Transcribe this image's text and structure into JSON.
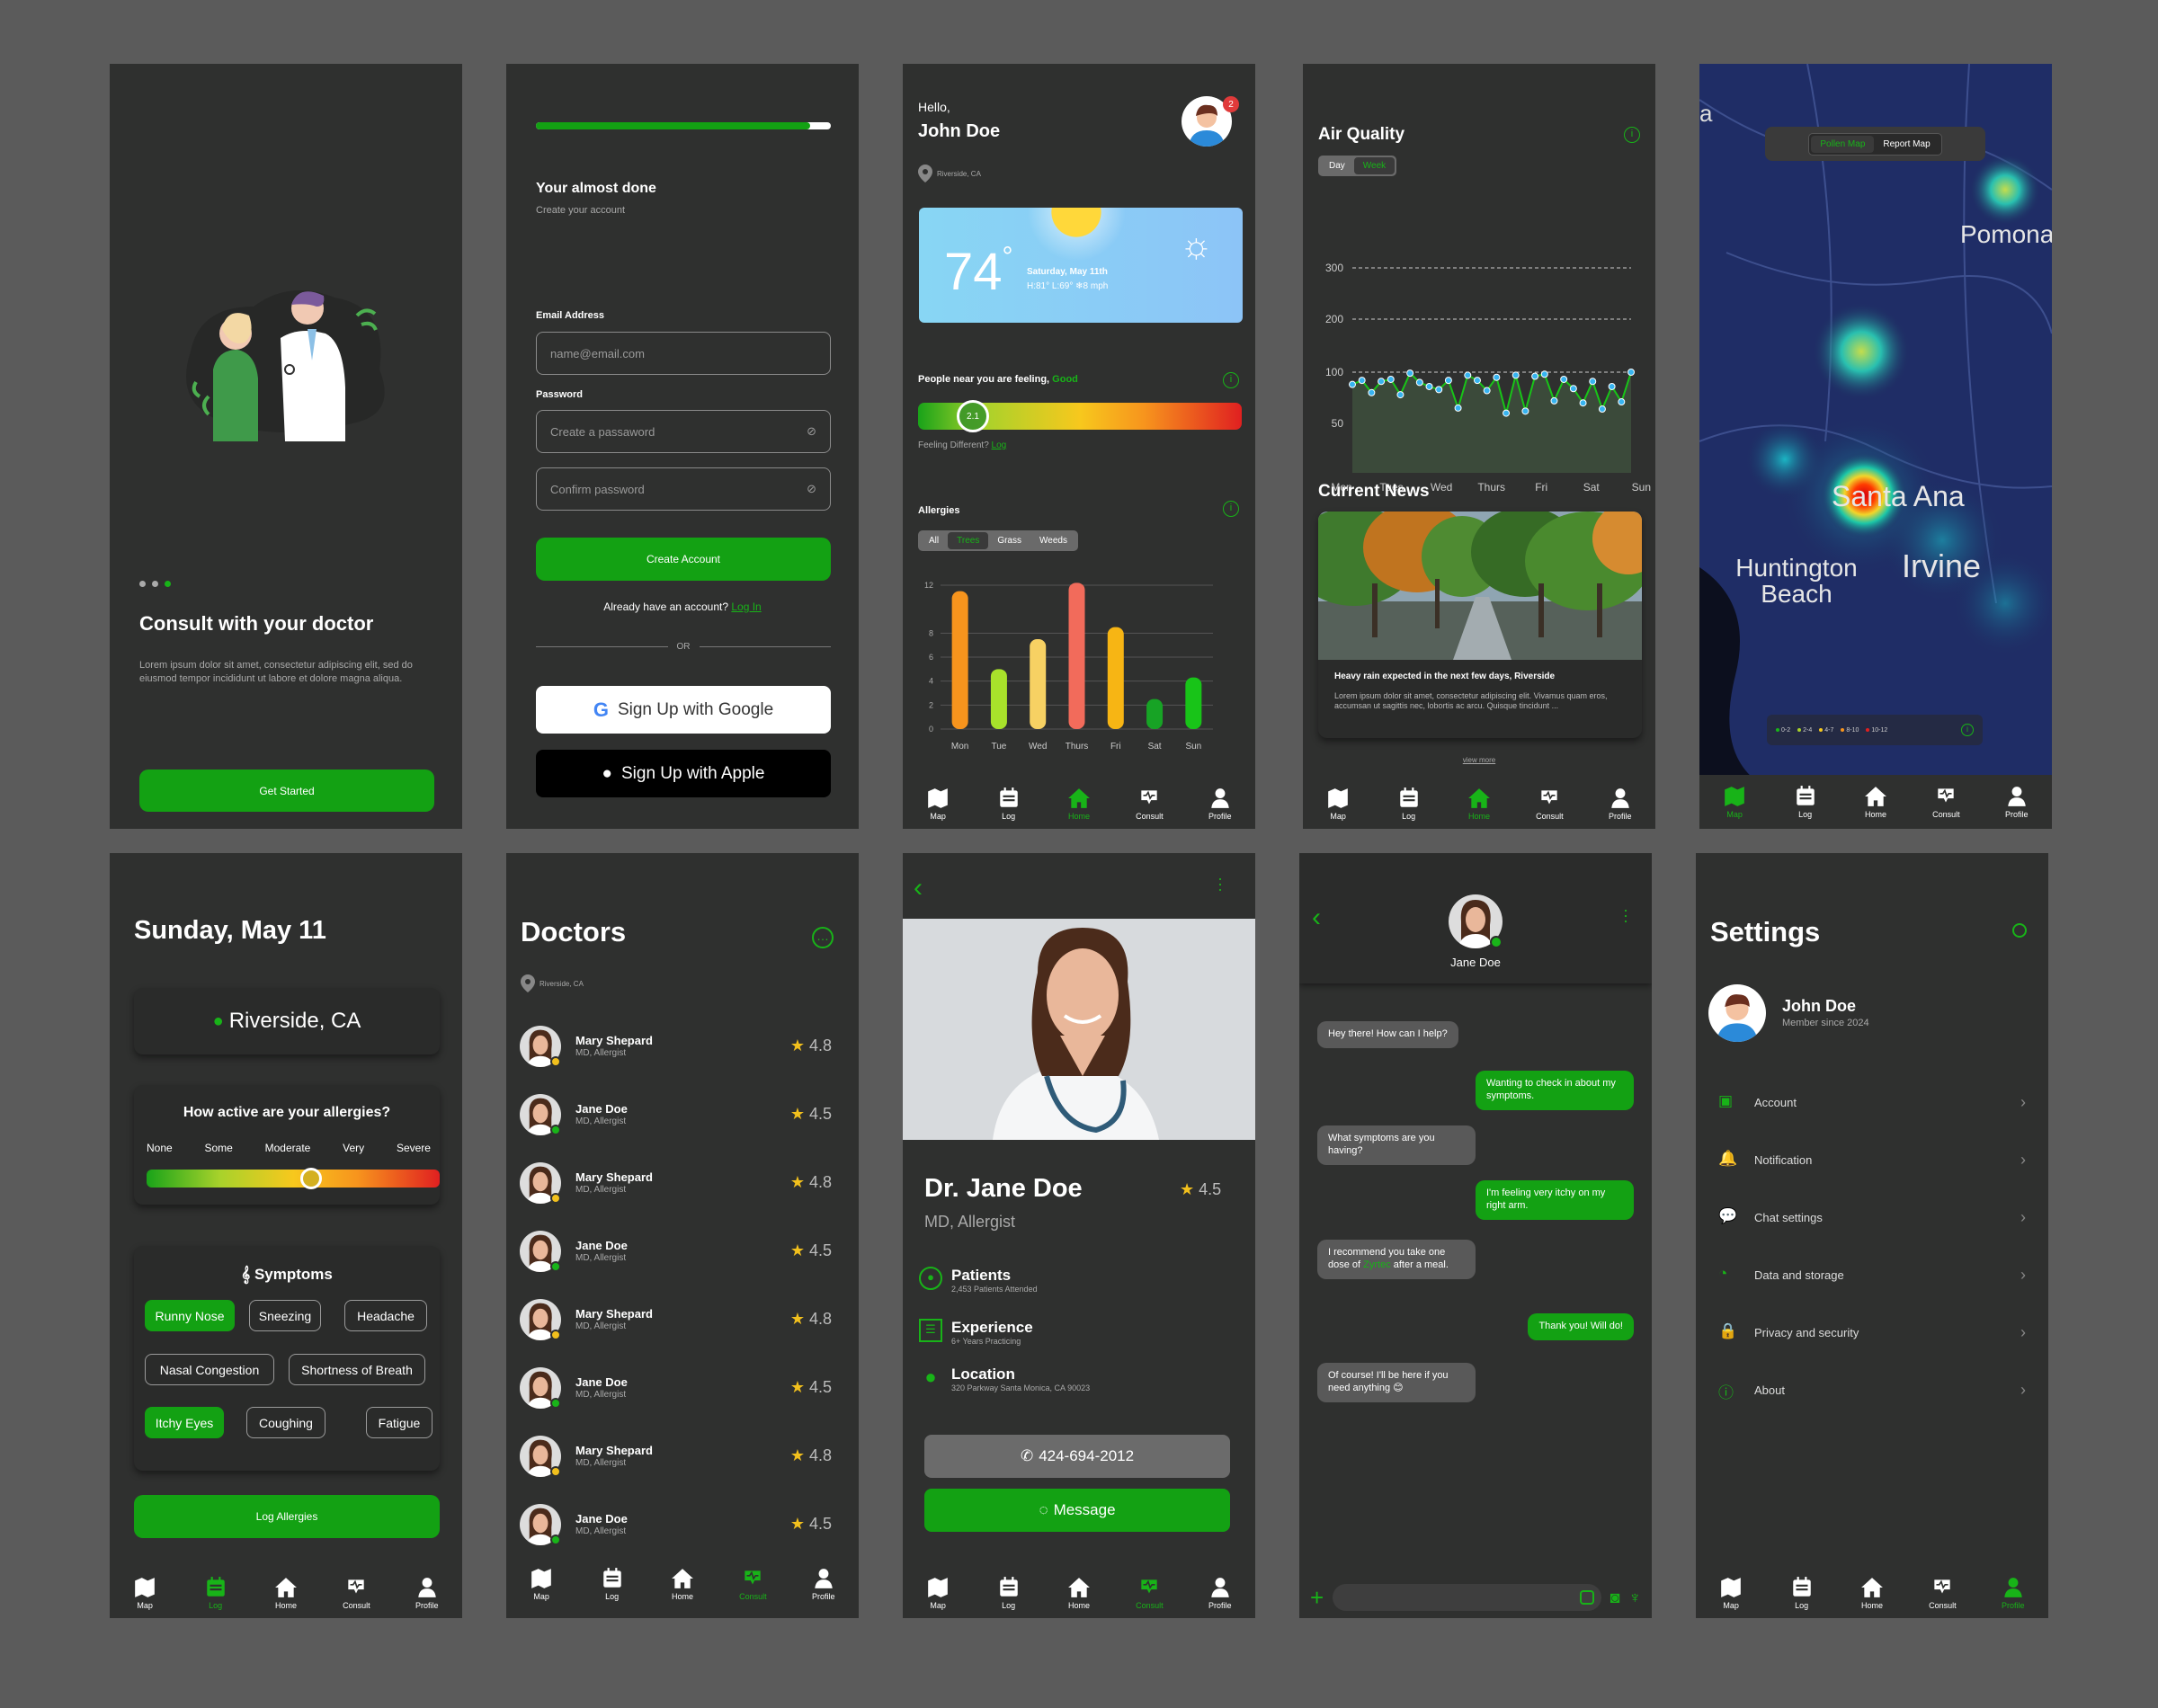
{
  "nav": {
    "map": "Map",
    "log": "Log",
    "home": "Home",
    "consult": "Consult",
    "profile": "Profile"
  },
  "s1": {
    "title": "Consult with your doctor",
    "body": "Lorem ipsum dolor sit amet, consectetur adipiscing elit, sed do eiusmod tempor incididunt ut labore et dolore magna aliqua.",
    "cta": "Get Started"
  },
  "s2": {
    "title": "Your almost done",
    "subtitle": "Create your account",
    "progress": 0.93,
    "email_label": "Email Address",
    "email_placeholder": "name@email.com",
    "password_label": "Password",
    "password_placeholder": "Create a passaword",
    "confirm_placeholder": "Confirm password",
    "create": "Create Account",
    "have_account": "Already have an account?",
    "login": "Log In",
    "or": "OR",
    "google": "Sign Up with Google",
    "apple": "Sign Up with Apple"
  },
  "s3": {
    "hello": "Hello,",
    "name": "John Doe",
    "badge": "2",
    "location": "Riverside, CA",
    "temp": "74",
    "date": "Saturday, May 11th",
    "hilo": "H:81° L:69°",
    "wind": "8 mph",
    "feeling_prefix": "People near you are feeling,",
    "feeling_value": "Good",
    "level": "2.1",
    "feeling_diff": "Feeling Different?",
    "log": "Log",
    "allergies": "Allergies",
    "tabs": [
      "All",
      "Trees",
      "Grass",
      "Weeds"
    ],
    "active_tab": "Trees"
  },
  "chart_allergy": {
    "type": "bar",
    "categories": [
      "Mon",
      "Tue",
      "Wed",
      "Thurs",
      "Fri",
      "Sat",
      "Sun"
    ],
    "values": [
      11.5,
      5,
      7.5,
      12.2,
      8.5,
      2.5,
      4.3
    ],
    "colors": [
      "#f7941d",
      "#a8e22b",
      "#f7d163",
      "#f26b5b",
      "#f7b514",
      "#17a325",
      "#18c418"
    ],
    "ylim": [
      0,
      12
    ],
    "yticks": [
      0,
      2,
      4,
      6,
      8,
      12
    ]
  },
  "s4": {
    "title": "Air Quality",
    "tabs": [
      "Day",
      "Week"
    ],
    "active_tab": "Week",
    "news_title": "Current News",
    "news_head": "Heavy rain expected in the next few days, Riverside",
    "news_body": "Lorem ipsum dolor sit amet, consectetur adipiscing elit. Vivamus quam eros, accumsan ut sagittis nec, lobortis ac arcu. Quisque tincidunt ...",
    "view_more": "view more"
  },
  "chart_air": {
    "type": "line",
    "x": [
      "Mon",
      "Tues",
      "Wed",
      "Thurs",
      "Fri",
      "Sat",
      "Sun"
    ],
    "values": [
      88,
      92,
      80,
      91,
      93,
      78,
      99,
      90,
      86,
      83,
      92,
      65,
      97,
      92,
      82,
      95,
      60,
      97,
      62,
      96,
      98,
      72,
      93,
      84,
      70,
      91,
      64,
      86,
      71,
      100
    ],
    "yticks": [
      50,
      100,
      200,
      300
    ],
    "grid": true
  },
  "s5": {
    "tabs": [
      "Pollen Map",
      "Report Map"
    ],
    "active_tab": "Pollen Map",
    "places": [
      "Pomona",
      "Santa Ana",
      "Huntington Beach",
      "Irvine"
    ],
    "legend": [
      "0-2",
      "2-4",
      "4-7",
      "8-10",
      "10-12"
    ],
    "legend_colors": [
      "#19b419",
      "#a8d22b",
      "#f7c81d",
      "#f7941d",
      "#e02020"
    ]
  },
  "s6": {
    "date": "Sunday, May 11",
    "location": "Riverside, CA",
    "question": "How active are your allergies?",
    "scale": [
      "None",
      "Some",
      "Moderate",
      "Very",
      "Severe"
    ],
    "level": 0.56,
    "symptoms_title": "Symptoms",
    "symptoms": [
      {
        "t": "Runny Nose",
        "on": true
      },
      {
        "t": "Sneezing",
        "on": false
      },
      {
        "t": "Headache",
        "on": false
      },
      {
        "t": "Nasal Congestion",
        "on": false
      },
      {
        "t": "Shortness of Breath",
        "on": false
      },
      {
        "t": "Itchy Eyes",
        "on": true
      },
      {
        "t": "Coughing",
        "on": false
      },
      {
        "t": "Fatigue",
        "on": false
      }
    ],
    "cta": "Log Allergies"
  },
  "s7": {
    "title": "Doctors",
    "location": "Riverside, CA",
    "doctors": [
      {
        "name": "Mary Shepard",
        "role": "MD, Allergist",
        "rating": "4.8",
        "status": "#f2c01d"
      },
      {
        "name": "Jane Doe",
        "role": "MD, Allergist",
        "rating": "4.5",
        "status": "#19b419"
      },
      {
        "name": "Mary Shepard",
        "role": "MD, Allergist",
        "rating": "4.8",
        "status": "#f2c01d"
      },
      {
        "name": "Jane Doe",
        "role": "MD, Allergist",
        "rating": "4.5",
        "status": "#19b419"
      },
      {
        "name": "Mary Shepard",
        "role": "MD, Allergist",
        "rating": "4.8",
        "status": "#f2c01d"
      },
      {
        "name": "Jane Doe",
        "role": "MD, Allergist",
        "rating": "4.5",
        "status": "#19b419"
      },
      {
        "name": "Mary Shepard",
        "role": "MD, Allergist",
        "rating": "4.8",
        "status": "#f2c01d"
      },
      {
        "name": "Jane Doe",
        "role": "MD, Allergist",
        "rating": "4.5",
        "status": "#19b419"
      }
    ]
  },
  "s8": {
    "name": "Dr. Jane Doe",
    "role": "MD, Allergist",
    "rating": "4.5",
    "patients": "Patients",
    "patients_sub": "2,453 Patients Attended",
    "experience": "Experience",
    "experience_sub": "6+ Years Practicing",
    "location": "Location",
    "location_sub": "320 Parkway Santa Monica, CA 90023",
    "phone": "424-694-2012",
    "message": "Message"
  },
  "s9": {
    "name": "Jane Doe",
    "messages": [
      {
        "dir": "in",
        "t": "Hey there! How can I help?"
      },
      {
        "dir": "out",
        "t": "Wanting to check in about my symptoms."
      },
      {
        "dir": "in",
        "t": "What symptoms are you having?"
      },
      {
        "dir": "out",
        "t": "I'm feeling very itchy on my right arm."
      },
      {
        "dir": "in",
        "pre": "I recommend you take one dose of ",
        "link": "Zyrtec",
        "post": " after a meal."
      },
      {
        "dir": "out",
        "t": "Thank you! Will do!"
      },
      {
        "dir": "in",
        "t": "Of course! I'll be here if you need anything 😊"
      }
    ]
  },
  "s10": {
    "title": "Settings",
    "name": "John Doe",
    "member": "Member since 2024",
    "items": [
      "Account",
      "Notification",
      "Chat settings",
      "Data and storage",
      "Privacy and security",
      "About"
    ]
  }
}
